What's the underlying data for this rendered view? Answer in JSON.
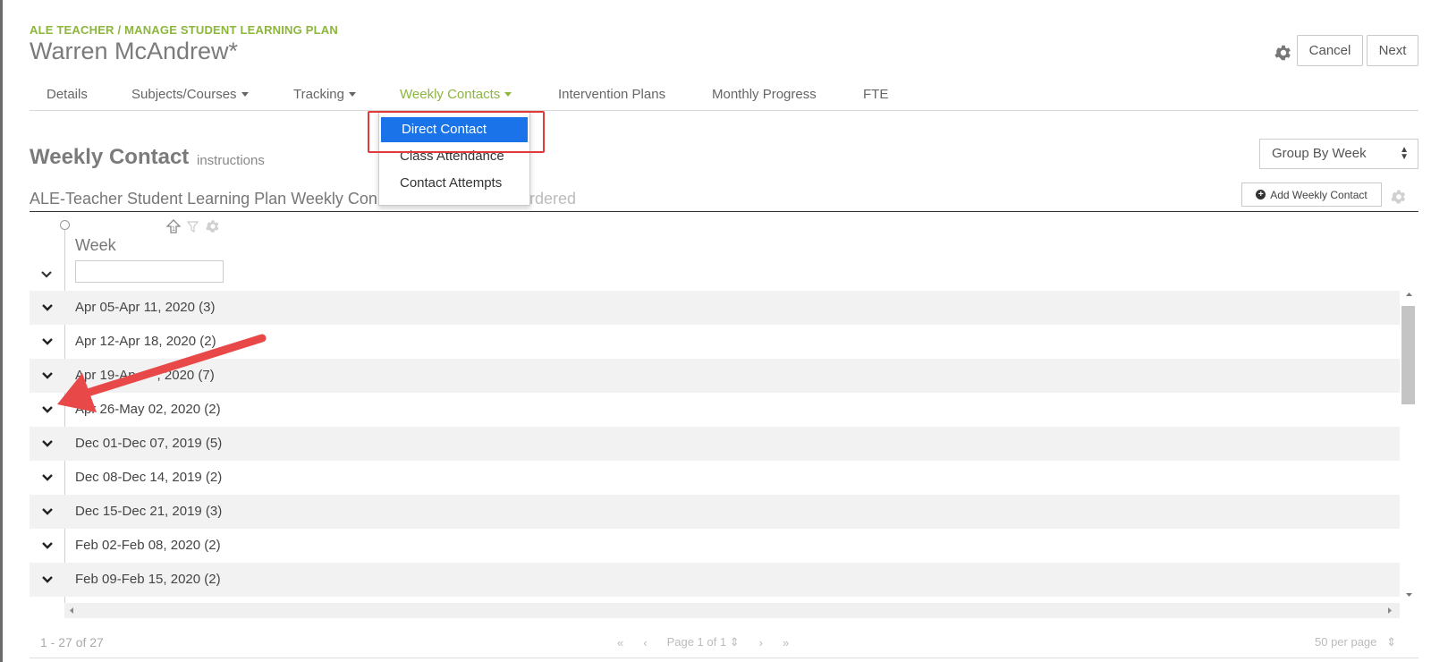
{
  "header": {
    "breadcrumb": "ALE TEACHER / MANAGE STUDENT LEARNING PLAN",
    "title": "Warren McAndrew*",
    "cancel_label": "Cancel",
    "next_label": "Next"
  },
  "tabs": [
    {
      "label": "Details"
    },
    {
      "label": "Subjects/Courses"
    },
    {
      "label": "Tracking"
    },
    {
      "label": "Weekly Contacts",
      "active": true
    },
    {
      "label": "Intervention Plans"
    },
    {
      "label": "Monthly Progress"
    },
    {
      "label": "FTE"
    }
  ],
  "dropdown": {
    "items": [
      {
        "label": "Direct Contact",
        "selected": true
      },
      {
        "label": "Class Attendance"
      },
      {
        "label": "Contact Attempts"
      }
    ]
  },
  "section": {
    "title": "Weekly Contact",
    "instructions_link": "instructions",
    "grid_title": "ALE-Teacher Student Learning Plan Weekly Con",
    "grid_title_rest": "rdered",
    "group_select": "Group By Week",
    "add_button": "Add Weekly Contact"
  },
  "grid": {
    "column_header": "Week",
    "rows": [
      {
        "label": "Apr 05-Apr 11, 2020 (3)"
      },
      {
        "label": "Apr 12-Apr 18, 2020 (2)"
      },
      {
        "label": "Apr 19-Ap",
        "label_rest": ", 2020 (7)"
      },
      {
        "label": "Apr 26-May 02, 2020 (2)"
      },
      {
        "label": "Dec 01-Dec 07, 2019 (5)"
      },
      {
        "label": "Dec 08-Dec 14, 2019 (2)"
      },
      {
        "label": "Dec 15-Dec 21, 2019 (3)"
      },
      {
        "label": "Feb 02-Feb 08, 2020 (2)"
      },
      {
        "label": "Feb 09-Feb 15, 2020 (2)"
      }
    ]
  },
  "pager": {
    "count": "1 - 27 of 27",
    "page_label": "Page 1 of 1",
    "page_size": "50 per page"
  },
  "colors": {
    "accent_green": "#8cb63c",
    "selected_blue": "#1a73e8",
    "annotation_red": "#e03a3a"
  }
}
